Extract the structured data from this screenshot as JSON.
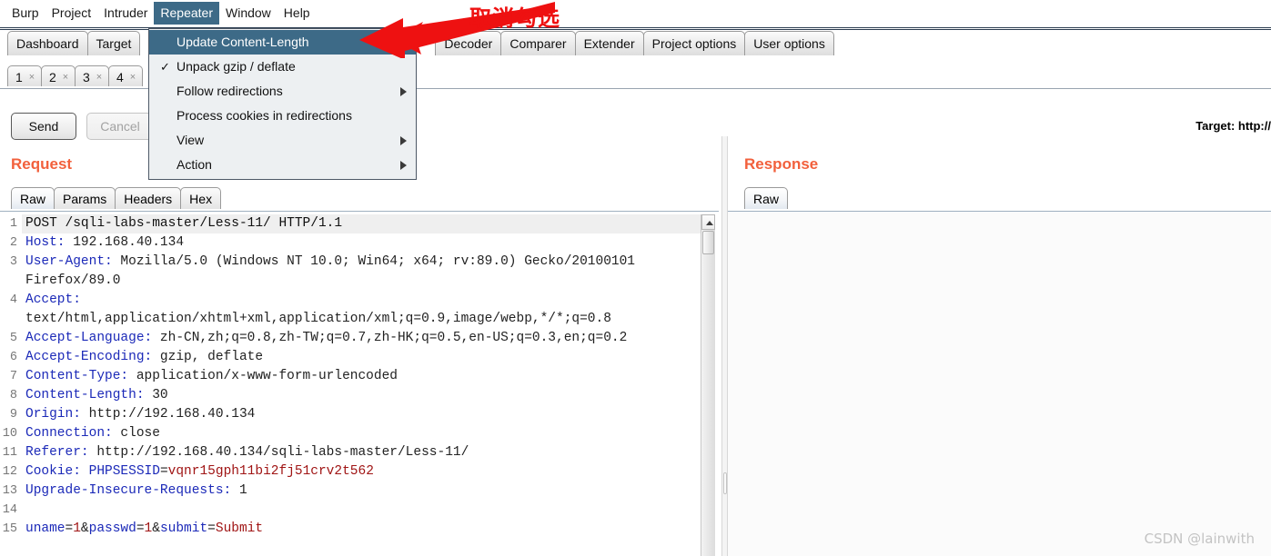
{
  "menubar": {
    "items": [
      {
        "label": "Burp",
        "open": false
      },
      {
        "label": "Project",
        "open": false
      },
      {
        "label": "Intruder",
        "open": false
      },
      {
        "label": "Repeater",
        "open": true
      },
      {
        "label": "Window",
        "open": false
      },
      {
        "label": "Help",
        "open": false
      }
    ]
  },
  "repeater_menu": {
    "items": [
      {
        "label": "Update Content-Length",
        "checked": false,
        "submenu": false,
        "selected": true
      },
      {
        "label": "Unpack gzip / deflate",
        "checked": true,
        "submenu": false,
        "selected": false
      },
      {
        "label": "Follow redirections",
        "checked": false,
        "submenu": true,
        "selected": false
      },
      {
        "label": "Process cookies in redirections",
        "checked": false,
        "submenu": false,
        "selected": false
      },
      {
        "label": "View",
        "checked": false,
        "submenu": true,
        "selected": false
      },
      {
        "label": "Action",
        "checked": false,
        "submenu": true,
        "selected": false
      }
    ],
    "check_glyph": "✓",
    "highlight_color": "#3d6a87"
  },
  "main_tabs": [
    {
      "label": "Dashboard"
    },
    {
      "label": "Target"
    },
    {
      "label": "Decoder"
    },
    {
      "label": "Comparer"
    },
    {
      "label": "Extender"
    },
    {
      "label": "Project options"
    },
    {
      "label": "User options"
    }
  ],
  "repeater_tabs": [
    {
      "number": "1",
      "close": "×"
    },
    {
      "number": "2",
      "close": "×"
    },
    {
      "number": "3",
      "close": "×"
    },
    {
      "number": "4",
      "close": "×"
    }
  ],
  "toolbar": {
    "send_label": "Send",
    "cancel_label": "Cancel",
    "target_label": "Target: http://"
  },
  "request": {
    "title": "Request",
    "tabs": [
      {
        "label": "Raw",
        "active": true
      },
      {
        "label": "Params",
        "active": false
      },
      {
        "label": "Headers",
        "active": false
      },
      {
        "label": "Hex",
        "active": false
      }
    ],
    "lines": [
      {
        "n": "1",
        "segments": [
          {
            "t": "POST /sqli-labs-master/Less-11/ HTTP/1.1",
            "c": "blk"
          }
        ]
      },
      {
        "n": "2",
        "segments": [
          {
            "t": "Host:",
            "c": "hdr"
          },
          {
            "t": " 192.168.40.134",
            "c": "val"
          }
        ]
      },
      {
        "n": "3",
        "segments": [
          {
            "t": "User-Agent:",
            "c": "hdr"
          },
          {
            "t": " Mozilla/5.0 (Windows NT 10.0; Win64; x64; rv:89.0) Gecko/20100101",
            "c": "val"
          }
        ]
      },
      {
        "n": "",
        "segments": [
          {
            "t": "Firefox/89.0",
            "c": "val"
          }
        ]
      },
      {
        "n": "4",
        "segments": [
          {
            "t": "Accept:",
            "c": "hdr"
          }
        ]
      },
      {
        "n": "",
        "segments": [
          {
            "t": "text/html,application/xhtml+xml,application/xml;q=0.9,image/webp,*/*;q=0.8",
            "c": "val"
          }
        ]
      },
      {
        "n": "5",
        "segments": [
          {
            "t": "Accept-Language:",
            "c": "hdr"
          },
          {
            "t": " zh-CN,zh;q=0.8,zh-TW;q=0.7,zh-HK;q=0.5,en-US;q=0.3,en;q=0.2",
            "c": "val"
          }
        ]
      },
      {
        "n": "6",
        "segments": [
          {
            "t": "Accept-Encoding:",
            "c": "hdr"
          },
          {
            "t": " gzip, deflate",
            "c": "val"
          }
        ]
      },
      {
        "n": "7",
        "segments": [
          {
            "t": "Content-Type:",
            "c": "hdr"
          },
          {
            "t": " application/x-www-form-urlencoded",
            "c": "val"
          }
        ]
      },
      {
        "n": "8",
        "segments": [
          {
            "t": "Content-Length:",
            "c": "hdr"
          },
          {
            "t": " 30",
            "c": "val"
          }
        ]
      },
      {
        "n": "9",
        "segments": [
          {
            "t": "Origin:",
            "c": "hdr"
          },
          {
            "t": " http://192.168.40.134",
            "c": "val"
          }
        ]
      },
      {
        "n": "10",
        "segments": [
          {
            "t": "Connection:",
            "c": "hdr"
          },
          {
            "t": " close",
            "c": "val"
          }
        ]
      },
      {
        "n": "11",
        "segments": [
          {
            "t": "Referer:",
            "c": "hdr"
          },
          {
            "t": " http://192.168.40.134/sqli-labs-master/Less-11/",
            "c": "val"
          }
        ]
      },
      {
        "n": "12",
        "segments": [
          {
            "t": "Cookie:",
            "c": "hdr"
          },
          {
            "t": " ",
            "c": "val"
          },
          {
            "t": "PHPSESSID",
            "c": "pkey"
          },
          {
            "t": "=",
            "c": "val"
          },
          {
            "t": "vqnr15gph11bi2fj51crv2t562",
            "c": "pval"
          }
        ]
      },
      {
        "n": "13",
        "segments": [
          {
            "t": "Upgrade-Insecure-Requests:",
            "c": "hdr"
          },
          {
            "t": " 1",
            "c": "val"
          }
        ]
      },
      {
        "n": "14",
        "segments": [
          {
            "t": "",
            "c": "val"
          }
        ]
      },
      {
        "n": "15",
        "segments": [
          {
            "t": "uname",
            "c": "pkey"
          },
          {
            "t": "=",
            "c": "val"
          },
          {
            "t": "1",
            "c": "pval"
          },
          {
            "t": "&",
            "c": "val"
          },
          {
            "t": "passwd",
            "c": "pkey"
          },
          {
            "t": "=",
            "c": "val"
          },
          {
            "t": "1",
            "c": "pval"
          },
          {
            "t": "&",
            "c": "val"
          },
          {
            "t": "submit",
            "c": "pkey"
          },
          {
            "t": "=",
            "c": "val"
          },
          {
            "t": "Submit",
            "c": "pval"
          }
        ]
      }
    ]
  },
  "response": {
    "title": "Response",
    "tabs": [
      {
        "label": "Raw",
        "active": true
      }
    ],
    "body": ""
  },
  "annotation": {
    "text": "取消勾选",
    "color": "#ee1111"
  },
  "watermark": "CSDN @lainwith"
}
